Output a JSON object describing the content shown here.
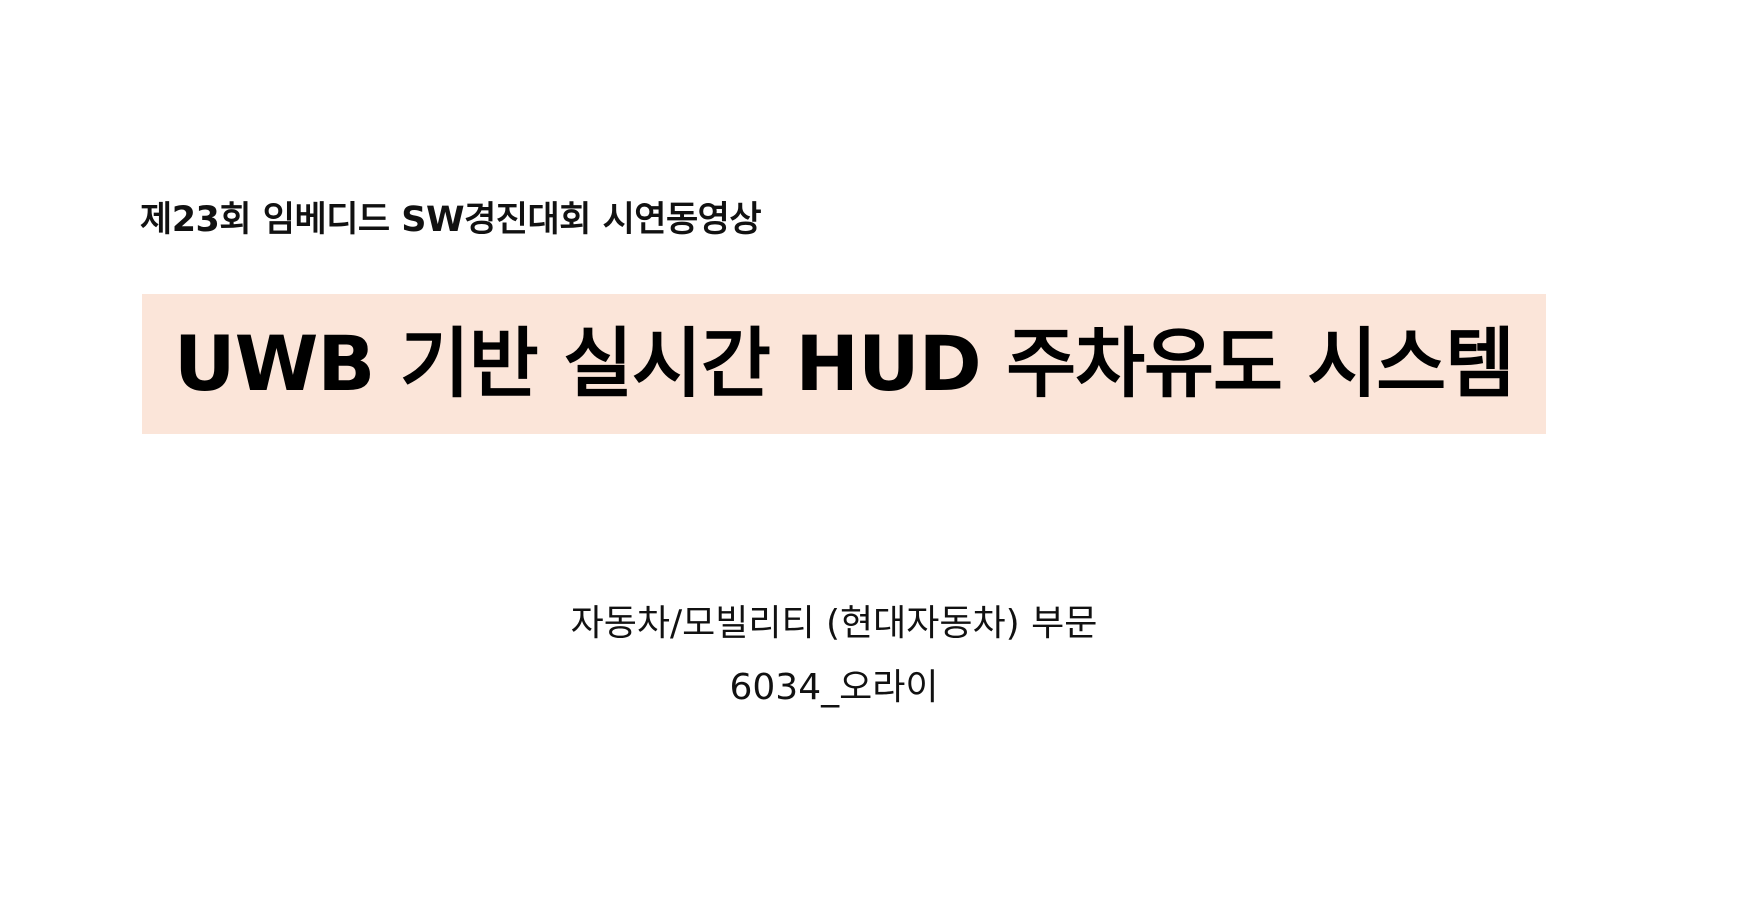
{
  "slide": {
    "event_title": "제23회 임베디드 SW경진대회 시연동영상",
    "main_title": "UWB 기반 실시간 HUD 주차유도 시스템",
    "category": "자동차/모빌리티 (현대자동차) 부문",
    "team": "6034_오라이",
    "colors": {
      "title_highlight": "#fbe5d9",
      "text": "#111111",
      "background": "#ffffff"
    }
  }
}
